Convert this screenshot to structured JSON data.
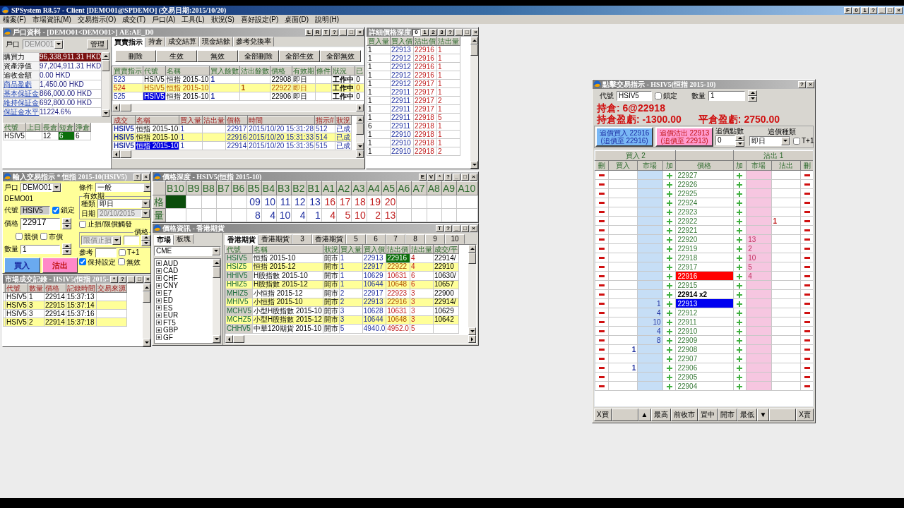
{
  "window": {
    "title": "SPSystem R8.57 - Client [DEMO01@SPDEMO] (交易日期:2015/10/20)",
    "controls": [
      "F",
      "0",
      "1",
      "?",
      "_",
      "□",
      "×"
    ]
  },
  "menu": [
    "檔案(F)",
    "市場資訊(M)",
    "交易指示(O)",
    "成交(T)",
    "戶口(A)",
    "工具(L)",
    "狀況(S)",
    "喜好設定(P)",
    "桌面(D)",
    "說明(H)"
  ],
  "account": {
    "title": "戶口資料 - [DEMO01<DEMO01>] AE:AE_D0",
    "controls": [
      "L",
      "R",
      "T",
      "?",
      "_",
      "□",
      "×"
    ],
    "account_label": "戶口",
    "account_value": "DEMO01",
    "manage_button": "管理",
    "summary": [
      {
        "label": "購買力",
        "value": "96,338,911.31 HKD",
        "highlight": true,
        "link": false
      },
      {
        "label": "資產淨值",
        "value": "97,204,911.31 HKD",
        "highlight": false,
        "link": false
      },
      {
        "label": "追收金額",
        "value": "0.00 HKD",
        "highlight": false,
        "link": false
      },
      {
        "label": "商品盈虧",
        "value": "1,450.00 HKD",
        "highlight": false,
        "link": true
      },
      {
        "label": "基本保証金",
        "value": "866,000.00 HKD",
        "highlight": false,
        "link": true
      },
      {
        "label": "維持保証金",
        "value": "692,800.00 HKD",
        "highlight": false,
        "link": true
      },
      {
        "label": "保証金水平",
        "value": "11224.6%",
        "highlight": false,
        "link": true
      }
    ],
    "positions": {
      "columns": [
        "代號",
        "上日",
        "長倉",
        "短倉",
        "淨倉"
      ],
      "rows": [
        {
          "code": "HSIV5",
          "long": "12",
          "short": "6",
          "net": "6",
          "short_highlight": true
        }
      ]
    },
    "tabs": [
      {
        "label": "買賣指示",
        "selected": true
      },
      {
        "label": "持倉",
        "selected": false
      },
      {
        "label": "成交結算",
        "selected": false
      },
      {
        "label": "現金結餘",
        "selected": false
      },
      {
        "label": "參考兌換率",
        "selected": false
      }
    ],
    "buttons": [
      "刪除",
      "生效",
      "無效",
      "全部刪除",
      "全部生效",
      "全部無效"
    ],
    "orders": {
      "columns": [
        "買賣指示",
        "代號",
        "名稱",
        "買入餘數",
        "沽出餘數",
        "價格",
        "有效期",
        "條件",
        "狀況",
        "已"
      ],
      "rows": [
        {
          "id": "523",
          "code": "HSIV5",
          "name": "恒指 2015-10",
          "buy_qty": "1",
          "price": "22908",
          "validity": "即日",
          "status": "工作中",
          "filled": "0",
          "selected": false
        },
        {
          "id": "524",
          "code": "HSIV5",
          "name": "恒指 2015-10",
          "sell_qty": "1",
          "price": "22922",
          "validity": "即日",
          "status": "工作中",
          "filled": "0",
          "selected": false
        },
        {
          "id": "525",
          "code": "HSIV5",
          "name": "恒指 2015-10",
          "buy_qty": "1",
          "price": "22906",
          "validity": "即日",
          "status": "工作中",
          "filled": "0",
          "selected": true
        }
      ]
    },
    "trades": {
      "columns": [
        "成交",
        "名稱",
        "買入量",
        "沽出量",
        "價格",
        "時間",
        "指示#",
        "狀況"
      ],
      "rows": [
        {
          "code": "HSIV5",
          "name": "恒指 2015-10",
          "buy_qty": "1",
          "price": "22917",
          "time": "2015/10/20 15:31:28",
          "order": "512",
          "status": "已成",
          "selected": false
        },
        {
          "code": "HSIV5",
          "name": "恒指 2015-10",
          "buy_qty": "1",
          "price": "22916",
          "time": "2015/10/20 15:31:33",
          "order": "514",
          "status": "已成",
          "selected": false
        },
        {
          "code": "HSIV5",
          "name": "恒指 2015-10",
          "buy_qty": "1",
          "price": "22914",
          "time": "2015/10/20 15:31:35",
          "order": "515",
          "status": "已成",
          "selected": true
        }
      ]
    }
  },
  "depth": {
    "title": "詳細價格深度",
    "tabs": [
      {
        "label": "0",
        "selected": true
      },
      {
        "label": "1",
        "selected": false
      },
      {
        "label": "2",
        "selected": false
      },
      {
        "label": "3",
        "selected": false
      }
    ],
    "controls": [
      "?",
      "_",
      "□",
      "×"
    ],
    "columns": [
      "買入量",
      "買入價",
      "沽出價",
      "沽出量"
    ],
    "rows": [
      [
        "1",
        "22913",
        "22916",
        "1"
      ],
      [
        "1",
        "22912",
        "22916",
        "1"
      ],
      [
        "1",
        "22912",
        "22916",
        "1"
      ],
      [
        "1",
        "22912",
        "22916",
        "1"
      ],
      [
        "1",
        "22912",
        "22917",
        "1"
      ],
      [
        "1",
        "22911",
        "22917",
        "1"
      ],
      [
        "1",
        "22911",
        "22917",
        "2"
      ],
      [
        "1",
        "22911",
        "22917",
        "1"
      ],
      [
        "1",
        "22911",
        "22918",
        "5"
      ],
      [
        "6",
        "22911",
        "22918",
        "1"
      ],
      [
        "1",
        "22910",
        "22918",
        "1"
      ],
      [
        "1",
        "22910",
        "22918",
        "1"
      ],
      [
        "1",
        "22910",
        "22918",
        "2"
      ]
    ]
  },
  "order_entry": {
    "title": "輸入交易指示 * 恒指 2015-10(HSIV5)",
    "controls": [
      "?",
      "×"
    ],
    "account_label": "戶口",
    "account": "DEMO01",
    "account_name": "DEMO01",
    "code_label": "代號",
    "code": "HSIV5",
    "code_disabled": true,
    "lock": {
      "label": "鎖定",
      "checked": true
    },
    "price_label": "價格",
    "price": "22917",
    "auction": {
      "label": "競價",
      "checked": false
    },
    "market": {
      "label": "市價",
      "checked": false
    },
    "qty_label": "數量",
    "qty": "1",
    "condition_label": "條件",
    "condition": "一般",
    "validity_label": "有效期",
    "type_label": "種類",
    "type": "即日",
    "date_label": "日期",
    "date": "20/10/2015",
    "date_disabled": true,
    "stop": {
      "label": "止損/限價觸發",
      "checked": false
    },
    "stop_price_label": "價格",
    "stop_type": "限價止損",
    "stop_type_disabled": true,
    "ref_label": "參考",
    "t1": {
      "label": "T+1",
      "checked": false
    },
    "buy_button": "買入",
    "sell_button": "沽出",
    "keep": {
      "label": "保持設定",
      "checked": true
    },
    "inactive": {
      "label": "無效",
      "checked": false
    }
  },
  "market_trades": {
    "title": "市場成交記錄 - HSIV5(恒指 2015-",
    "controls": [
      "*",
      "?",
      "_",
      "□",
      "×"
    ],
    "columns": [
      "代號",
      "數量",
      "價格",
      "記錄時間",
      "交易來源"
    ],
    "rows": [
      {
        "code": "HSIV5",
        "qty": "1",
        "price": "22914",
        "time": "15:37:13"
      },
      {
        "code": "HSIV5",
        "qty": "3",
        "price": "22915",
        "time": "15:37:14"
      },
      {
        "code": "HSIV5",
        "qty": "3",
        "price": "22914",
        "time": "15:37:16"
      },
      {
        "code": "HSIV5",
        "qty": "2",
        "price": "22914",
        "time": "15:37:18"
      }
    ]
  },
  "price_depth": {
    "title": "價格深度 - HSIV5(恒指 2015-10)",
    "controls": [
      "E",
      "V",
      "*",
      "?",
      "_",
      "□",
      "×"
    ],
    "row_labels": [
      "格",
      "量"
    ],
    "bids": [
      {
        "label": "B10",
        "marked": true
      },
      {
        "label": "B9",
        "marked": false
      },
      {
        "label": "B8",
        "marked": false
      },
      {
        "label": "B7",
        "marked": false
      },
      {
        "label": "B6",
        "marked": false
      },
      {
        "label": "B5",
        "marked": false,
        "price": "09",
        "qty": "8"
      },
      {
        "label": "B4",
        "marked": false,
        "price": "10",
        "qty": "4"
      },
      {
        "label": "B3",
        "marked": false,
        "price": "11",
        "qty": "10"
      },
      {
        "label": "B2",
        "marked": false,
        "price": "12",
        "qty": "4"
      },
      {
        "label": "B1",
        "marked": false,
        "price": "13",
        "qty": "1"
      }
    ],
    "asks": [
      {
        "label": "A1",
        "marked": false,
        "price": "16",
        "qty": "4"
      },
      {
        "label": "A2",
        "marked": false,
        "price": "17",
        "qty": "5"
      },
      {
        "label": "A3",
        "marked": false,
        "price": "18",
        "qty": "10"
      },
      {
        "label": "A4",
        "marked": false,
        "price": "19",
        "qty": "2"
      },
      {
        "label": "A5",
        "marked": false,
        "price": "20",
        "qty": "13"
      },
      {
        "label": "A6",
        "marked": false
      },
      {
        "label": "A7",
        "marked": false
      },
      {
        "label": "A8",
        "marked": false
      },
      {
        "label": "A9",
        "marked": false
      },
      {
        "label": "A10",
        "marked": false
      }
    ]
  },
  "price_info": {
    "title": "價格資訊 - 香港期貨",
    "controls": [
      "T",
      "?",
      "_",
      "□",
      "×"
    ],
    "side_tabs": [
      {
        "label": "市場",
        "selected": true
      },
      {
        "label": "板塊",
        "selected": false
      }
    ],
    "market": "CME",
    "tree": [
      {
        "label": "AUD",
        "expanded": false
      },
      {
        "label": "CAD",
        "expanded": false
      },
      {
        "label": "CHF",
        "expanded": false
      },
      {
        "label": "CNY",
        "expanded": false
      },
      {
        "label": "E7",
        "expanded": false
      },
      {
        "label": "ED",
        "expanded": false
      },
      {
        "label": "ES",
        "expanded": false
      },
      {
        "label": "EUR",
        "expanded": false
      },
      {
        "label": "FT5",
        "expanded": false
      },
      {
        "label": "GBP",
        "expanded": false
      },
      {
        "label": "GF",
        "expanded": false
      }
    ],
    "tabs": [
      {
        "label": "香港期貨",
        "selected": true
      },
      {
        "label": "香港期貨",
        "selected": false
      },
      {
        "label": "3",
        "selected": false
      },
      {
        "label": "香港期貨",
        "selected": false
      },
      {
        "label": "5",
        "selected": false
      },
      {
        "label": "6",
        "selected": false
      },
      {
        "label": "7",
        "selected": false
      },
      {
        "label": "8",
        "selected": false
      },
      {
        "label": "9",
        "selected": false
      },
      {
        "label": "10",
        "selected": false
      }
    ],
    "columns": [
      "代號",
      "名稱",
      "狀況",
      "買入量",
      "買入價",
      "沽出價",
      "沽出量",
      "成交/平"
    ],
    "rows": [
      {
        "code": "HSIV5",
        "name": "恒指 2015-10",
        "status": "開市",
        "bid_qty": "1",
        "bid": "22913",
        "ask": "22916",
        "ask_qty": "4",
        "last": "22914/",
        "ask_marked": true
      },
      {
        "code": "HSIZ5",
        "name": "恒指 2015-12",
        "status": "開市",
        "bid_qty": "1",
        "bid": "22917",
        "ask": "22922",
        "ask_qty": "4",
        "last": "22910",
        "ask_marked": false
      },
      {
        "code": "HHIV5",
        "name": "H股指數 2015-10",
        "status": "開市",
        "bid_qty": "1",
        "bid": "10629",
        "ask": "10631",
        "ask_qty": "6",
        "last": "10630/",
        "ask_marked": false
      },
      {
        "code": "HHIZ5",
        "name": "H股指數 2015-12",
        "status": "開市",
        "bid_qty": "1",
        "bid": "10644",
        "ask": "10648",
        "ask_qty": "6",
        "last": "10657",
        "ask_marked": false
      },
      {
        "code": "MHIZ5",
        "name": "小恒指 2015-12",
        "status": "開市",
        "bid_qty": "2",
        "bid": "22917",
        "ask": "22923",
        "ask_qty": "3",
        "last": "22900",
        "ask_marked": false
      },
      {
        "code": "MHIV5",
        "name": "小恒指 2015-10",
        "status": "開市",
        "bid_qty": "2",
        "bid": "22913",
        "ask": "22916",
        "ask_qty": "3",
        "last": "22914/",
        "ask_marked": false
      },
      {
        "code": "MCHV5",
        "name": "小型H股指數 2015-10",
        "status": "開市",
        "bid_qty": "3",
        "bid": "10628",
        "ask": "10631",
        "ask_qty": "3",
        "last": "10629",
        "ask_marked": false
      },
      {
        "code": "MCHZ5",
        "name": "小型H股指數 2015-12",
        "status": "開市",
        "bid_qty": "3",
        "bid": "10644",
        "ask": "10648",
        "ask_qty": "3",
        "last": "10642",
        "ask_marked": false
      },
      {
        "code": "CHHV5",
        "name": "中華120期貨 2015-10",
        "status": "開市",
        "bid_qty": "5",
        "bid": "4940.0",
        "ask": "4952.0",
        "ask_qty": "5",
        "ask_marked": false
      }
    ]
  },
  "ladder": {
    "title": "點擊交易指示 - HSIV5(恒指 2015-10)",
    "controls": [
      "?",
      "×"
    ],
    "code_label": "代號",
    "code": "HSIV5",
    "lock": {
      "label": "鎖定",
      "checked": false
    },
    "qty_label": "數量",
    "qty": "1",
    "position": "持倉: 6@22918",
    "open_pnl": "持倉盈虧: -1300.00",
    "closed_pnl": "平倉盈虧: 2750.00",
    "buy_button": [
      "追價買入 22916",
      "(追價至 22916)"
    ],
    "sell_button": [
      "追價沽出 22913",
      "(追價至 22913)"
    ],
    "chase_points_label": "追價點數",
    "chase_points": "0",
    "chase_type_label": "追價種類",
    "chase_type": "即日",
    "t1": {
      "label": "T+1",
      "checked": false
    },
    "groups": [
      "買入 2",
      "沽出 1"
    ],
    "columns": [
      "刪",
      "買入",
      "市場",
      "加",
      "價格",
      "加",
      "市場",
      "沽出",
      "刪"
    ],
    "rows": [
      {
        "price": "22927",
        "kind": "plain"
      },
      {
        "price": "22926",
        "kind": "plain"
      },
      {
        "price": "22925",
        "kind": "plain"
      },
      {
        "price": "22924",
        "kind": "plain"
      },
      {
        "price": "22923",
        "kind": "plain"
      },
      {
        "price": "22922",
        "kind": "plain",
        "my_sell": "1"
      },
      {
        "price": "22921",
        "kind": "plain"
      },
      {
        "price": "22920",
        "kind": "plain",
        "ask_market": "13"
      },
      {
        "price": "22919",
        "kind": "plain",
        "ask_market": "2"
      },
      {
        "price": "22918",
        "kind": "plain",
        "ask_market": "10"
      },
      {
        "price": "22917",
        "kind": "plain",
        "ask_market": "5"
      },
      {
        "price": "22916",
        "kind": "ask",
        "ask_market": "4"
      },
      {
        "price": "22915",
        "kind": "plain"
      },
      {
        "price": "22914 x2",
        "kind": "last"
      },
      {
        "price": "22913",
        "kind": "bid",
        "bid_market": "1"
      },
      {
        "price": "22912",
        "kind": "plain",
        "bid_market": "4"
      },
      {
        "price": "22911",
        "kind": "plain",
        "bid_market": "10"
      },
      {
        "price": "22910",
        "kind": "plain",
        "bid_market": "4"
      },
      {
        "price": "22909",
        "kind": "plain",
        "bid_market": "8"
      },
      {
        "price": "22908",
        "kind": "plain",
        "my_buy": "1"
      },
      {
        "price": "22907",
        "kind": "plain"
      },
      {
        "price": "22906",
        "kind": "plain",
        "my_buy": "1"
      },
      {
        "price": "22905",
        "kind": "plain"
      },
      {
        "price": "22904",
        "kind": "plain"
      }
    ],
    "bottom": [
      {
        "kind": "button",
        "label": "X買"
      },
      {
        "kind": "blank"
      },
      {
        "kind": "button",
        "label": "▲"
      },
      {
        "kind": "button",
        "label": "最高"
      },
      {
        "kind": "button",
        "label": "前收市"
      },
      {
        "kind": "button",
        "label": "置中"
      },
      {
        "kind": "button",
        "label": "開市"
      },
      {
        "kind": "button",
        "label": "最低"
      },
      {
        "kind": "button",
        "label": "▼"
      },
      {
        "kind": "blank"
      },
      {
        "kind": "button",
        "label": "X賣"
      }
    ]
  }
}
